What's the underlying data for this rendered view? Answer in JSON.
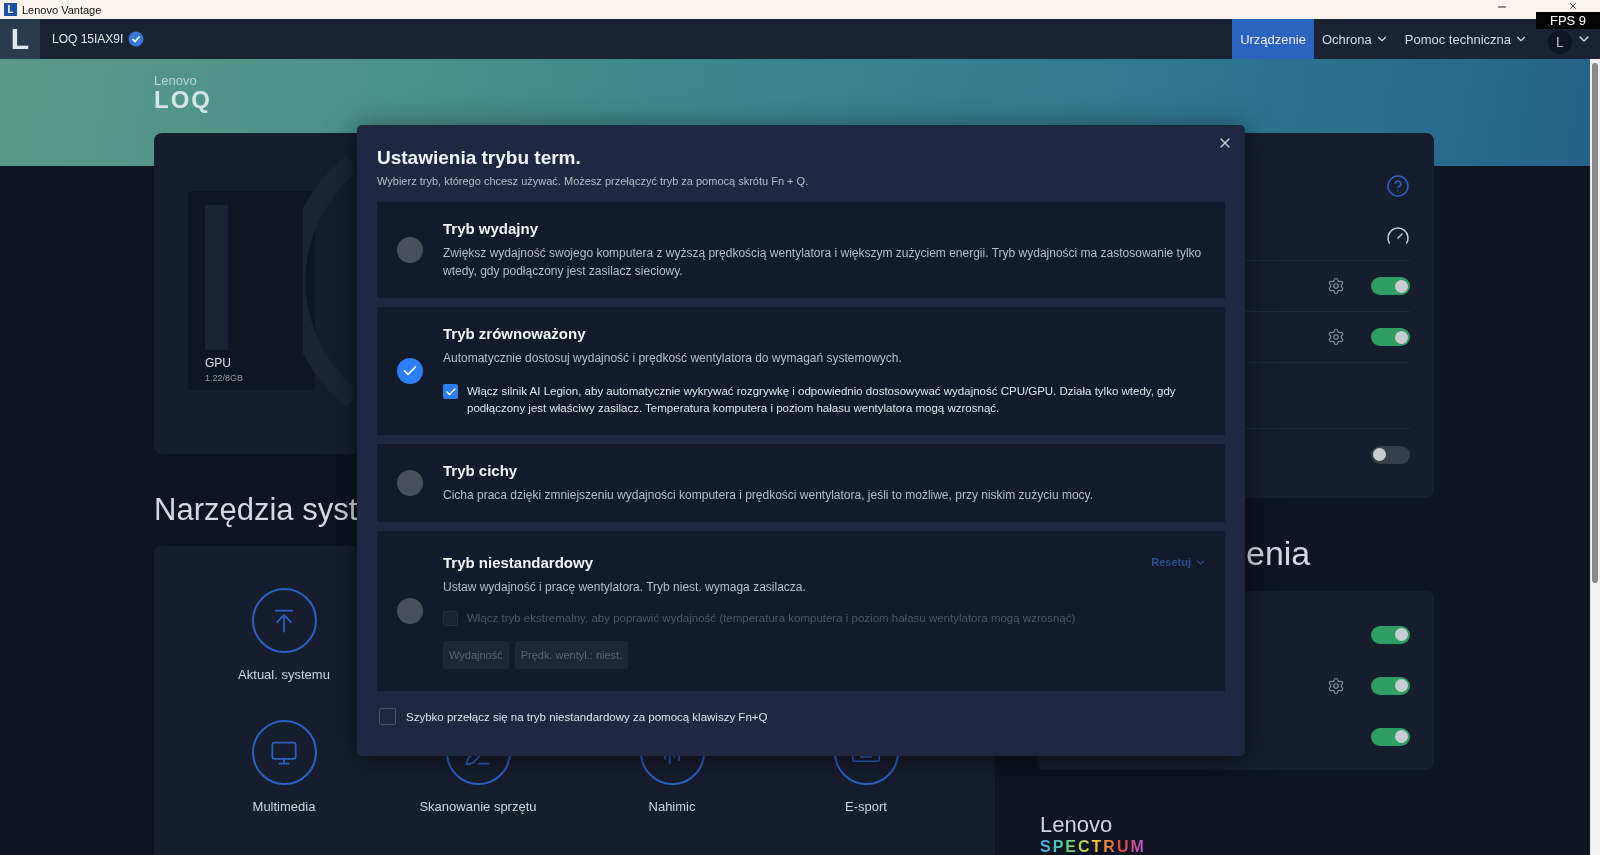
{
  "window": {
    "logo": "L",
    "title": "Lenovo Vantage",
    "overlay": "FPS 9"
  },
  "topbar": {
    "logo": "L",
    "device": "LOQ 15IAX9I",
    "nav": [
      {
        "label": "Urządzenie",
        "selected": true,
        "dropdown": false
      },
      {
        "label": "Ochrona",
        "selected": false,
        "dropdown": true
      },
      {
        "label": "Pomoc techniczna",
        "selected": false,
        "dropdown": true
      }
    ],
    "avatar": "L"
  },
  "banner": {
    "brand": "Lenovo",
    "product": "LOQ"
  },
  "gpu": {
    "label": "GPU",
    "usage": "1.22/8GB"
  },
  "tools": {
    "heading": "Narzędzia syst",
    "rows": [
      [
        {
          "label": "Aktual. systemu"
        }
      ],
      [
        {
          "label": "Multimedia"
        },
        {
          "label": "Skanowanie sprzętu"
        },
        {
          "label": "Nahimic"
        },
        {
          "label": "E-sport"
        }
      ]
    ]
  },
  "status_panel": {
    "rows": [
      {
        "kind": "help"
      },
      {
        "kind": "gauge"
      },
      {
        "kind": "toggle",
        "settings": true,
        "on": true
      },
      {
        "kind": "toggle",
        "settings": true,
        "on": true
      },
      {
        "kind": "toggle",
        "settings": false,
        "on": false
      }
    ]
  },
  "settings_panel": {
    "heading": "enia",
    "rows": [
      {
        "settings": false,
        "on": true
      },
      {
        "settings": true,
        "on": true
      },
      {
        "settings": false,
        "on": true
      }
    ]
  },
  "spectrum": {
    "brand": "Lenovo",
    "product": "SPECTRUM"
  },
  "dialog": {
    "title": "Ustawienia trybu term.",
    "subtitle": "Wybierz tryb, którego chcesz używać. Możesz przełączyć tryb za pomocą skrótu Fn + Q.",
    "modes": [
      {
        "title": "Tryb wydajny",
        "description": "Zwiększ wydajność swojego komputera z wyższą prędkością wentylatora i większym zużyciem energii. Tryb wydajności ma zastosowanie tylko wtedy, gdy podłączony jest zasilacz sieciowy.",
        "selected": false
      },
      {
        "title": "Tryb zrównoważony",
        "description": "Automatycznie dostosuj wydajność i prędkość wentylatora do wymagań systemowych.",
        "selected": true,
        "option": {
          "label": "Włącz silnik AI Legion, aby automatycznie wykrywać rozgrywkę i odpowiednio dostosowywać wydajność CPU/GPU. Działa tylko wtedy, gdy podłączony jest właściwy zasilacz. Temperatura komputera i poziom hałasu wentylatora mogą wzrosnąć.",
          "checked": true,
          "disabled": false
        }
      },
      {
        "title": "Tryb cichy",
        "description": "Cicha praca dzięki zmniejszeniu wydajności komputera i prędkości wentylatora, jeśli to możliwe, przy niskim zużyciu mocy.",
        "selected": false
      },
      {
        "title": "Tryb niestandardowy",
        "description": "Ustaw wydajność i pracę wentylatora. Tryb niest. wymaga zasilacza.",
        "selected": false,
        "reset": "Resetuj",
        "option": {
          "label": "Włącz tryb ekstremalny, aby poprawić wydajność (temperatura komputera i poziom hałasu wentylatora mogą wzrosnąć)",
          "checked": false,
          "disabled": true
        },
        "buttons": [
          {
            "label": "Wydajność",
            "disabled": true
          },
          {
            "label": "Prędk. wentyl.: niest.",
            "disabled": true
          }
        ]
      }
    ],
    "quick_switch": {
      "label": "Szybko przełącz się na tryb niestandardowy za pomocą klawiszy Fn+Q",
      "checked": false
    }
  }
}
